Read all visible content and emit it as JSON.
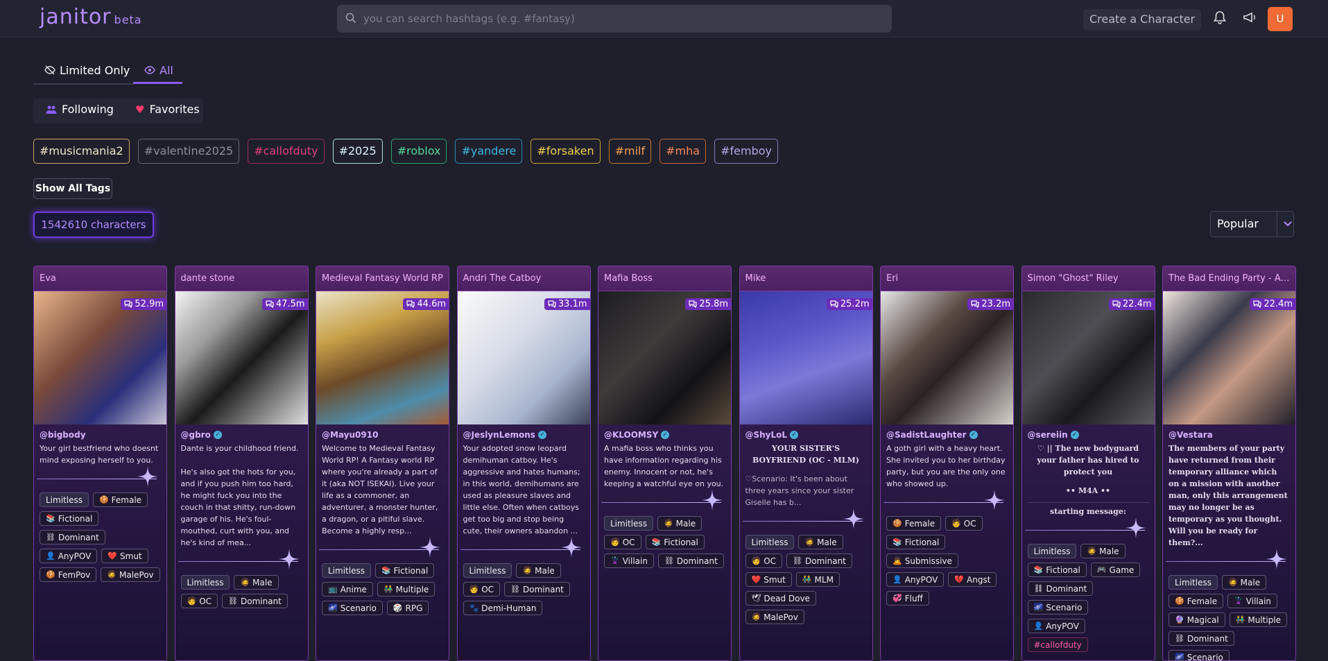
{
  "app": {
    "logo": "janitor",
    "beta": "beta",
    "search_placeholder": "you can search hashtags (e.g. #fantasy)",
    "create_label": "Create a Character",
    "avatar_letter": "U"
  },
  "filters": {
    "limited_label": "Limited Only",
    "all_label": "All",
    "following_label": "Following",
    "favorites_label": "Favorites"
  },
  "tags": [
    {
      "label": "#musicmania2",
      "color": "#f2e6c4",
      "border": "#c9a866"
    },
    {
      "label": "#valentine2025",
      "color": "#8d8f99",
      "border": "#65666f"
    },
    {
      "label": "#callofduty",
      "color": "#e0417a",
      "border": "#a02a58"
    },
    {
      "label": "#2025",
      "color": "#e0f0ff",
      "border": "#a8e0d8"
    },
    {
      "label": "#roblox",
      "color": "#55d49a",
      "border": "#2e9e6c"
    },
    {
      "label": "#yandere",
      "color": "#3cb8e0",
      "border": "#2a8ab0"
    },
    {
      "label": "#forsaken",
      "color": "#f3d051",
      "border": "#c4a22a"
    },
    {
      "label": "#milf",
      "color": "#f3a04c",
      "border": "#c4782a"
    },
    {
      "label": "#mha",
      "color": "#f38a5c",
      "border": "#c46234"
    },
    {
      "label": "#femboy",
      "color": "#b8a6e8",
      "border": "#8a78bc"
    }
  ],
  "show_all_tags": "Show All Tags",
  "count_label": "1542610 characters",
  "sort": {
    "selected": "Popular"
  },
  "cards": [
    {
      "title": "Eva",
      "chats": "52.9m",
      "author": "@bigbody",
      "verified": false,
      "style": "n",
      "desc": "Your girl bestfriend who doesnt mind exposing herself to you.",
      "pills": [
        [
          "Limitless",
          "",
          1
        ],
        [
          "Female",
          "🍪"
        ],
        [
          "Fictional",
          "📚"
        ],
        [
          "Dominant",
          "⛓"
        ],
        [
          "AnyPOV",
          "👤"
        ],
        [
          "Smut",
          "❤️"
        ],
        [
          "FemPov",
          "🍪"
        ],
        [
          "MalePov",
          "🧔"
        ]
      ],
      "bg": "linear-gradient(135deg,#e7b58a 0%,#7a4a3a 40%,#2a2f7a 70%,#c8c6d8 100%)"
    },
    {
      "title": "dante stone",
      "chats": "47.5m",
      "author": "@gbro",
      "verified": true,
      "style": "n",
      "desc": "Dante is your childhood friend.\n\nHe's also got the hots for you, and if you push him too hard, he might fuck you into the couch in that shitty, run-down garage of his. He's foul-mouthed, curt with you, and he's kind of mea...",
      "pills": [
        [
          "Limitless",
          "",
          1
        ],
        [
          "Male",
          "🧔"
        ],
        [
          "OC",
          "🧑"
        ],
        [
          "Dominant",
          "⛓"
        ]
      ],
      "bg": "linear-gradient(135deg,#f4f4f4 0%,#9a9a9a 30%,#1a1a1a 55%,#e0e0e0 100%)"
    },
    {
      "title": "Medieval Fantasy World RP",
      "chats": "44.6m",
      "author": "@Mayu0910",
      "verified": false,
      "style": "n",
      "desc": "Welcome to Medieval Fantasy World RP! A Fantasy world RP where you're already a part of it (aka NOT ISEKAI). Live your life as a commoner, an adventurer, a monster hunter, a dragon, or a pitiful slave. Become a highly resp...",
      "pills": [
        [
          "Limitless",
          "",
          1
        ],
        [
          "Fictional",
          "📚"
        ],
        [
          "Anime",
          "📺"
        ],
        [
          "Multiple",
          "👬"
        ],
        [
          "Scenario",
          "🌌"
        ],
        [
          "RPG",
          "🎲"
        ]
      ],
      "bg": "linear-gradient(160deg,#e9e3c8 0%,#c8a048 30%,#6d4a28 55%,#4e8caa 80%,#a45a34 100%)"
    },
    {
      "title": "Andri The Catboy",
      "chats": "33.1m",
      "author": "@JeslynLemons",
      "verified": true,
      "style": "n",
      "desc": "Your adopted snow leopard demihuman catboy. He's aggressive and hates humans; in this world, demihumans are used as pleasure slaves and little else. Often when catboys get too big and stop being cute, their owners abandon ...",
      "pills": [
        [
          "Limitless",
          "",
          1
        ],
        [
          "Male",
          "🧔"
        ],
        [
          "OC",
          "🧑"
        ],
        [
          "Dominant",
          "⛓"
        ],
        [
          "Demi-Human",
          "🐾"
        ]
      ],
      "bg": "linear-gradient(135deg,#fbfbfb 0%,#d8dde8 40%,#a9b6cf 70%,#3a4258 100%)"
    },
    {
      "title": "Mafia Boss",
      "chats": "25.8m",
      "author": "@KLOOMSY",
      "verified": true,
      "style": "n",
      "desc": "A mafia boss who thinks you have information regarding his enemy. Innocent or not, he's keeping a watchful eye on you.",
      "pills": [
        [
          "Limitless",
          "",
          1
        ],
        [
          "Male",
          "🧔"
        ],
        [
          "OC",
          "🧑"
        ],
        [
          "Fictional",
          "📚"
        ],
        [
          "Villain",
          "🦹"
        ],
        [
          "Dominant",
          "⛓"
        ]
      ],
      "bg": "linear-gradient(135deg,#1c1c20 0%,#3e3a3a 40%,#121216 70%,#5a4a3a 100%)"
    },
    {
      "title": "Mike",
      "chats": "25.2m",
      "author": "@ShyLoL",
      "verified": true,
      "style": "b",
      "desc": "YOUR SISTER'S BOYFRIEND (OC - MLM)",
      "desc2": "♡Scenario: It's been about three years since your sister Giselle has b...",
      "pills": [
        [
          "Limitless",
          "",
          1
        ],
        [
          "Male",
          "🧔"
        ],
        [
          "OC",
          "🧑"
        ],
        [
          "Dominant",
          "⛓"
        ],
        [
          "Smut",
          "❤️"
        ],
        [
          "MLM",
          "👬"
        ],
        [
          "Dead Dove",
          "🕊"
        ],
        [
          "MalePov",
          "🧔"
        ]
      ],
      "bg": "linear-gradient(160deg,#3a3aa8 0%,#5a56c8 35%,#7c78d8 60%,#2a2a70 100%)"
    },
    {
      "title": "Eri",
      "chats": "23.2m",
      "author": "@SadistLaughter",
      "verified": true,
      "style": "n",
      "desc": "A goth girl with a heavy heart. She invited you to her birthday party, but you are the only one who showed up.",
      "pills": [
        [
          "Female",
          "🍪"
        ],
        [
          "OC",
          "🧑"
        ],
        [
          "Fictional",
          "📚"
        ],
        [
          "Submissive",
          "🙇"
        ],
        [
          "AnyPOV",
          "👤"
        ],
        [
          "Angst",
          "💔"
        ],
        [
          "Fluff",
          "💞"
        ]
      ],
      "bg": "linear-gradient(135deg,#e6e6e6 0%,#5a4a44 35%,#2a2222 55%,#d6d0cc 100%)"
    },
    {
      "title": "Simon \"Ghost\" Riley",
      "chats": "22.4m",
      "author": "@sereiin",
      "verified": true,
      "style": "b",
      "desc": "♡ || The new bodyguard your father has hired to protect you",
      "desc2": "•• M4A ••",
      "desc3": "starting message:",
      "pills": [
        [
          "Limitless",
          "",
          1
        ],
        [
          "Male",
          "🧔"
        ],
        [
          "Fictional",
          "📚"
        ],
        [
          "Game",
          "🎮"
        ],
        [
          "Dominant",
          "⛓"
        ],
        [
          "Scenario",
          "🌌"
        ],
        [
          "AnyPOV",
          "👤"
        ],
        [
          "#callofduty",
          "",
          2
        ]
      ],
      "bg": "linear-gradient(135deg,#2a2a2e 0%,#4e4e54 40%,#1a1a1c 65%,#5a5a60 100%)"
    },
    {
      "title": "The Bad Ending Party - Adventurers",
      "chats": "22.4m",
      "author": "@Vestara",
      "verified": false,
      "style": "bb",
      "desc": "The members of your party have returned from their temporary alliance which on a mission with another man, only this arrangement may no longer be as temporary as you thought. Will you be ready for them?...",
      "pills": [
        [
          "Limitless",
          "",
          1
        ],
        [
          "Male",
          "🧔"
        ],
        [
          "Female",
          "🍪"
        ],
        [
          "Villain",
          "🦹"
        ],
        [
          "Magical",
          "🔮"
        ],
        [
          "Multiple",
          "👬"
        ],
        [
          "Dominant",
          "⛓"
        ],
        [
          "Scenario",
          "🌌"
        ]
      ],
      "bg": "linear-gradient(135deg,#f0e6dc 0%,#3a3a4a 35%,#c49a84 60%,#1e1e28 100%)"
    }
  ]
}
